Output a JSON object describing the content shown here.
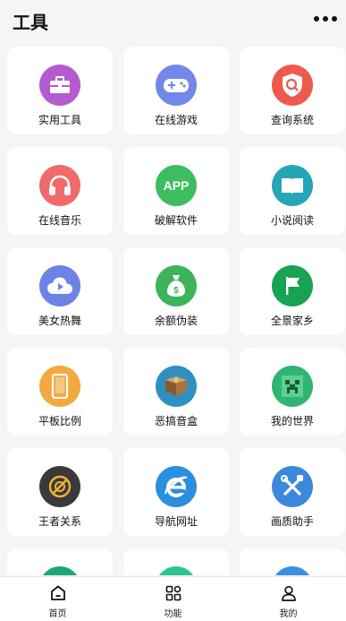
{
  "header": {
    "title": "工具"
  },
  "tools": [
    {
      "label": "实用工具",
      "icon": "toolbox-icon",
      "color": "#b45bd0"
    },
    {
      "label": "在线游戏",
      "icon": "gamepad-icon",
      "color": "#7288e8"
    },
    {
      "label": "查询系统",
      "icon": "shield-search-icon",
      "color": "#ee5a4e"
    },
    {
      "label": "在线音乐",
      "icon": "headphones-icon",
      "color": "#f06a6a"
    },
    {
      "label": "破解软件",
      "icon": "app-badge-icon",
      "color": "#3ebd5f",
      "icon_text": "APP"
    },
    {
      "label": "小说阅读",
      "icon": "book-icon",
      "color": "#26a5b8"
    },
    {
      "label": "美女热舞",
      "icon": "cloud-play-icon",
      "color": "#6c82e4"
    },
    {
      "label": "余额伪装",
      "icon": "money-bag-icon",
      "color": "#3eb45a"
    },
    {
      "label": "全景家乡",
      "icon": "flag-icon",
      "color": "#17a352"
    },
    {
      "label": "平板比例",
      "icon": "tablet-icon",
      "color": "#f2a93f"
    },
    {
      "label": "恶搞音盒",
      "icon": "music-box-icon",
      "color": "#2f8fc0"
    },
    {
      "label": "我的世界",
      "icon": "creeper-icon",
      "color": "#2fb572"
    },
    {
      "label": "王者关系",
      "icon": "target-icon",
      "color": "#3a3a3a"
    },
    {
      "label": "导航网址",
      "icon": "browser-ie-icon",
      "color": "#2a8fe0"
    },
    {
      "label": "画质助手",
      "icon": "tools-wrench-icon",
      "color": "#3b88dc"
    },
    {
      "label": "",
      "icon": "partial-icon",
      "color": "#1aa77a"
    },
    {
      "label": "",
      "icon": "partial-icon",
      "color": "#2cc490"
    },
    {
      "label": "",
      "icon": "partial-icon",
      "color": "#3a8ee6"
    }
  ],
  "tabbar": {
    "items": [
      {
        "label": "首页",
        "icon": "home-icon"
      },
      {
        "label": "功能",
        "icon": "grid-icon"
      },
      {
        "label": "我的",
        "icon": "user-icon"
      }
    ]
  }
}
